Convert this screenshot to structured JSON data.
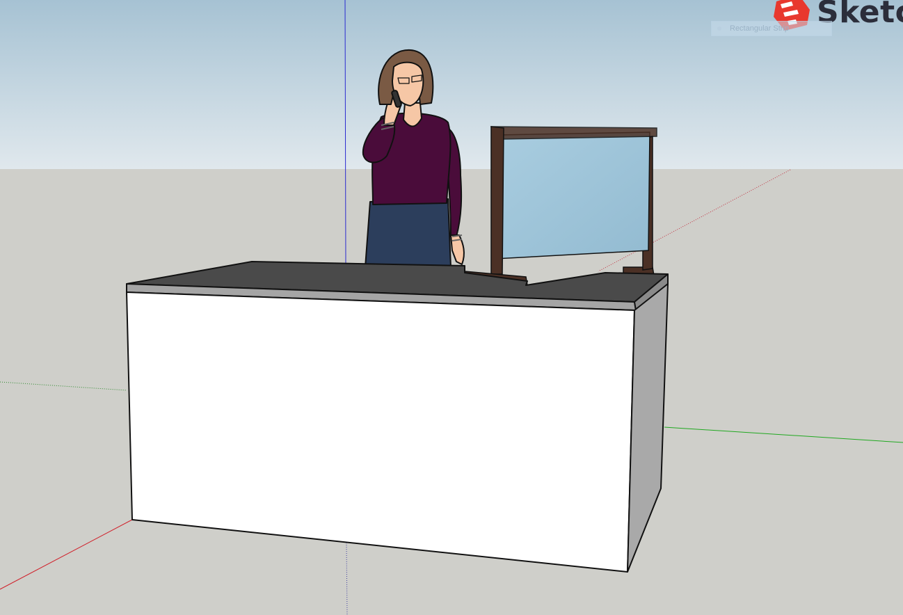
{
  "app": {
    "brand_name": "Sketc",
    "brand_icon": "sketchup-logo-icon"
  },
  "tooltip": {
    "label": "Rectangular Strip"
  },
  "colors": {
    "sky_top": "#a6c2d3",
    "sky_bottom": "#e0e8ed",
    "ground": "#cfcfca",
    "axis_red": "#d0202a",
    "axis_green": "#1fa81f",
    "axis_blue": "#2a2ad0",
    "desk_front": "#ffffff",
    "desk_side": "#a9a9a9",
    "desk_top": "#4a4a4a",
    "screen_glass": "#9ec4d8",
    "screen_frame": "#4b3025",
    "shirt": "#4a0c3a",
    "skirt": "#2c3e5c",
    "hair": "#7a5a44",
    "skin": "#f6c7a6",
    "logo": "#e8382e"
  }
}
